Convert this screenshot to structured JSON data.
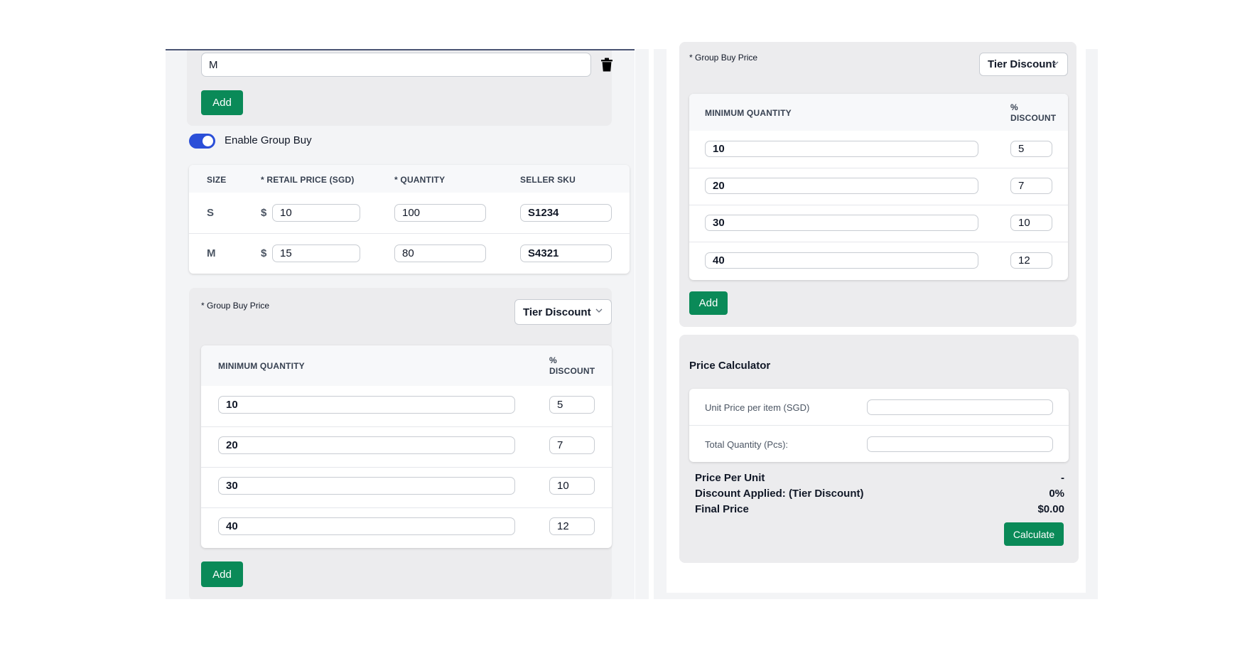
{
  "size_option": {
    "value": "M"
  },
  "add_size_label": "Add",
  "group_buy_toggle": {
    "label": "Enable Group Buy",
    "enabled": true
  },
  "variant_table": {
    "headers": [
      "SIZE",
      "* RETAIL PRICE (SGD)",
      "* QUANTITY",
      "SELLER SKU"
    ],
    "currency_symbol": "$",
    "rows": [
      {
        "size": "S",
        "price": "10",
        "quantity": "100",
        "sku": "S1234"
      },
      {
        "size": "M",
        "price": "15",
        "quantity": "80",
        "sku": "S4321"
      }
    ]
  },
  "group_buy": {
    "label": "* Group Buy Price",
    "select_value": "Tier Discount",
    "headers": [
      "MINIMUM QUANTITY",
      "%",
      "DISCOUNT"
    ],
    "tiers": [
      {
        "min_qty": "10",
        "discount": "5"
      },
      {
        "min_qty": "20",
        "discount": "7"
      },
      {
        "min_qty": "30",
        "discount": "10"
      },
      {
        "min_qty": "40",
        "discount": "12"
      }
    ],
    "add_label": "Add"
  },
  "calculator": {
    "title": "Price Calculator",
    "unit_price_label": "Unit Price per item (SGD)",
    "total_qty_label": "Total Quantity (Pcs):",
    "unit_price_value": "",
    "total_qty_value": "",
    "price_per_unit_label": "Price Per Unit",
    "price_per_unit_value": "-",
    "discount_label": "Discount Applied: (Tier Discount)",
    "discount_value": "0%",
    "final_price_label": "Final Price",
    "final_price_value": "$0.00",
    "calculate_label": "Calculate"
  },
  "colors": {
    "accent_green": "#0a8a58",
    "toggle_blue": "#2b4fd8",
    "panel_bg": "#f3f4f6"
  }
}
